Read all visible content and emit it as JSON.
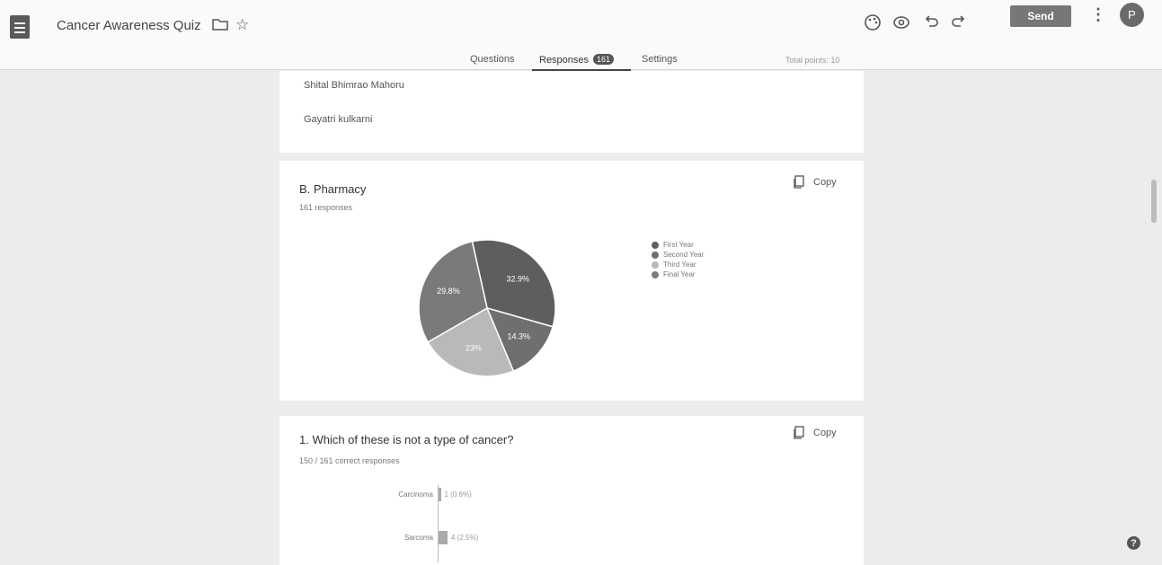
{
  "header": {
    "title": "Cancer Awareness Quiz",
    "send_label": "Send",
    "avatar_initial": "P",
    "icons": [
      "palette-icon",
      "preview-icon",
      "undo-icon",
      "redo-icon",
      "more-vert-icon"
    ]
  },
  "tabs": {
    "questions": "Questions",
    "responses": "Responses",
    "responses_count": "161",
    "settings": "Settings",
    "total_points": "Total points: 10"
  },
  "names": [
    "Shital Bhimrao Mahoru",
    "Gayatri kulkarni"
  ],
  "pharmacy": {
    "title": "B. Pharmacy",
    "subtitle": "161 responses",
    "copy_label": "Copy"
  },
  "quiz_question": {
    "title": "1. Which of these is not a type of cancer?",
    "subtitle": "150 / 161 correct responses",
    "copy_label": "Copy"
  },
  "chart_data": [
    {
      "type": "pie",
      "categories": [
        "First Year",
        "Second Year",
        "Third Year",
        "Final Year"
      ],
      "values": [
        32.9,
        14.3,
        23,
        29.8
      ],
      "value_labels": [
        "32.9%",
        "14.3%",
        "23%",
        "29.8%"
      ],
      "colors": [
        "#5e5e5e",
        "#6f6f6f",
        "#b9b9b9",
        "#7a7a7a"
      ],
      "legend_placement": "right"
    },
    {
      "type": "bar",
      "orientation": "horizontal",
      "categories": [
        "Carcinoma",
        "Sarcoma"
      ],
      "values": [
        1,
        4
      ],
      "value_labels": [
        "1 (0.6%)",
        "4 (2.5%)"
      ]
    }
  ],
  "help_icon": "?"
}
